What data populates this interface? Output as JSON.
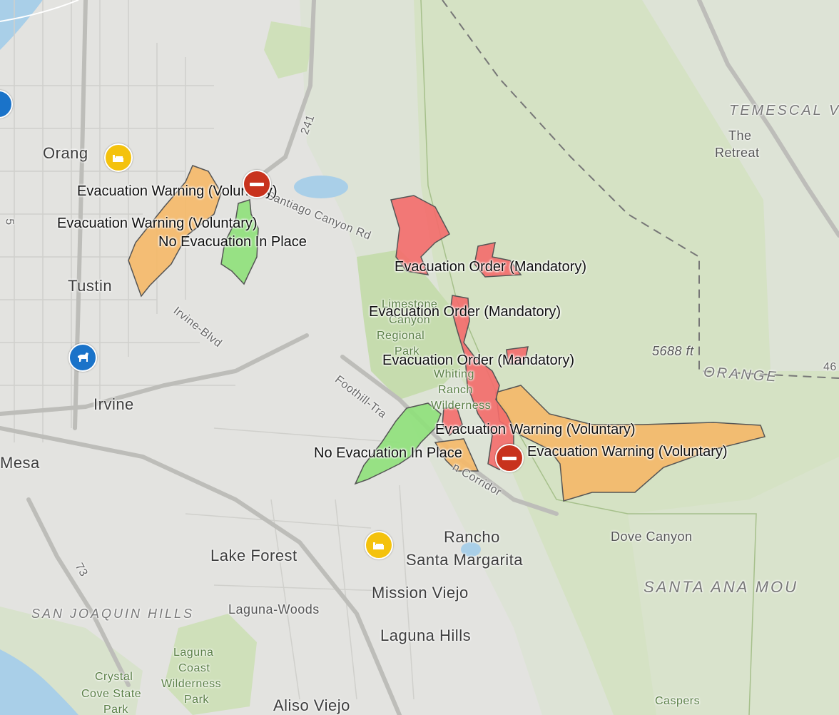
{
  "map": {
    "place_labels": [
      {
        "id": "orange",
        "text": "Orang"
      },
      {
        "id": "tustin",
        "text": "Tustin"
      },
      {
        "id": "irvine",
        "text": "Irvine"
      },
      {
        "id": "mesa",
        "text": "Mesa"
      },
      {
        "id": "lake-forest",
        "text": "Lake Forest"
      },
      {
        "id": "rancho",
        "text": "Rancho"
      },
      {
        "id": "santa-margarita",
        "text": "Santa Margarita"
      },
      {
        "id": "mission-viejo",
        "text": "Mission Viejo"
      },
      {
        "id": "laguna-woods",
        "text": "Laguna-Woods"
      },
      {
        "id": "laguna-hills",
        "text": "Laguna Hills"
      },
      {
        "id": "aliso-viejo",
        "text": "Aliso Viejo"
      },
      {
        "id": "dove-canyon",
        "text": "Dove Canyon"
      },
      {
        "id": "the",
        "text": "The"
      },
      {
        "id": "retreat",
        "text": "Retreat"
      },
      {
        "id": "temescal",
        "text": "TEMESCAL V"
      },
      {
        "id": "orange-county",
        "text": "ORANGE"
      },
      {
        "id": "santa-ana-mou",
        "text": "SANTA ANA MOU"
      },
      {
        "id": "san-joaquin-hills",
        "text": "SAN JOAQUIN HILLS"
      },
      {
        "id": "elevation",
        "text": "5688 ft"
      },
      {
        "id": "laguna-coast",
        "text": "Laguna"
      },
      {
        "id": "laguna-coast2",
        "text": "Coast"
      },
      {
        "id": "laguna-coast3",
        "text": "Wilderness"
      },
      {
        "id": "laguna-coast4",
        "text": "Park"
      },
      {
        "id": "crystal",
        "text": "Crystal"
      },
      {
        "id": "crystal2",
        "text": "Cove State"
      },
      {
        "id": "crystal3",
        "text": "Park"
      },
      {
        "id": "limestone",
        "text": "Limestone"
      },
      {
        "id": "limestone2",
        "text": "Canyon"
      },
      {
        "id": "limestone3",
        "text": "Regional"
      },
      {
        "id": "limestone4",
        "text": "Park"
      },
      {
        "id": "whiting",
        "text": "Whiting"
      },
      {
        "id": "whiting2",
        "text": "Ranch"
      },
      {
        "id": "whiting3",
        "text": "Wilderness"
      },
      {
        "id": "caspers",
        "text": "Caspers"
      },
      {
        "id": "santiago-rd",
        "text": "Santiago Canyon Rd"
      },
      {
        "id": "irvine-blvd",
        "text": "Irvine-Blvd"
      },
      {
        "id": "foothill",
        "text": "Foothill-Tra"
      },
      {
        "id": "corridor",
        "text": "n Corridor"
      },
      {
        "id": "rt241",
        "text": "241"
      },
      {
        "id": "rt73",
        "text": "73"
      },
      {
        "id": "rt5",
        "text": "5"
      },
      {
        "id": "rt46",
        "text": "46"
      }
    ],
    "evac_labels": [
      {
        "id": "warn1",
        "text": "Evacuation Warning (Voluntary)"
      },
      {
        "id": "warn2",
        "text": "Evacuation Warning (Voluntary)"
      },
      {
        "id": "none1",
        "text": "No Evacuation In Place"
      },
      {
        "id": "order1",
        "text": "Evacuation Order (Mandatory)"
      },
      {
        "id": "order2",
        "text": "Evacuation Order (Mandatory)"
      },
      {
        "id": "order3",
        "text": "Evacuation Order (Mandatory)"
      },
      {
        "id": "warn3",
        "text": "Evacuation Warning (Voluntary)"
      },
      {
        "id": "none2",
        "text": "No Evacuation In Place"
      },
      {
        "id": "warn4",
        "text": "Evacuation Warning (Voluntary)"
      }
    ],
    "poi_icons": [
      {
        "id": "shelter-orange",
        "icon": "shelter-icon"
      },
      {
        "id": "shelter-lakeforest",
        "icon": "shelter-icon"
      },
      {
        "id": "closure-north",
        "icon": "road-closure-icon"
      },
      {
        "id": "closure-south",
        "icon": "road-closure-icon"
      },
      {
        "id": "animal-irvine",
        "icon": "animal-shelter-icon"
      }
    ],
    "colors": {
      "warning": "#f5b868",
      "order": "#f46b6b",
      "none": "#8ee07a",
      "closure": "#c8321d",
      "shelter": "#f4c20d",
      "animal": "#1a73c9"
    }
  }
}
